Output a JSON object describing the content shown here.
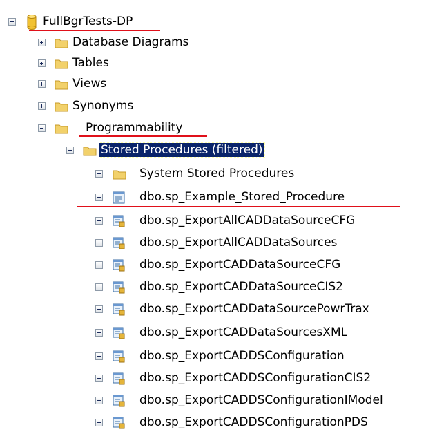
{
  "tree": {
    "database": "FullBgrTests-DP",
    "database_children": [
      "Database Diagrams",
      "Tables",
      "Views",
      "Synonyms",
      "Programmability"
    ],
    "programmability_children": [
      "Stored Procedures (filtered)"
    ],
    "stored_procedures": {
      "folder": "System Stored Procedures",
      "items": [
        "dbo.sp_Example_Stored_Procedure",
        "dbo.sp_ExportAllCADDataSourceCFG",
        "dbo.sp_ExportAllCADDataSources",
        "dbo.sp_ExportCADDataSourceCFG",
        "dbo.sp_ExportCADDataSourceCIS2",
        "dbo.sp_ExportCADDataSourcePowrTrax",
        "dbo.sp_ExportCADDataSourcesXML",
        "dbo.sp_ExportCADDSConfiguration",
        "dbo.sp_ExportCADDSConfigurationCIS2",
        "dbo.sp_ExportCADDSConfigurationIModel",
        "dbo.sp_ExportCADDSConfigurationPDS"
      ]
    }
  },
  "colors": {
    "selection": "#0a246a",
    "annotation": "#e0101a",
    "folder": "#f2d16b"
  }
}
